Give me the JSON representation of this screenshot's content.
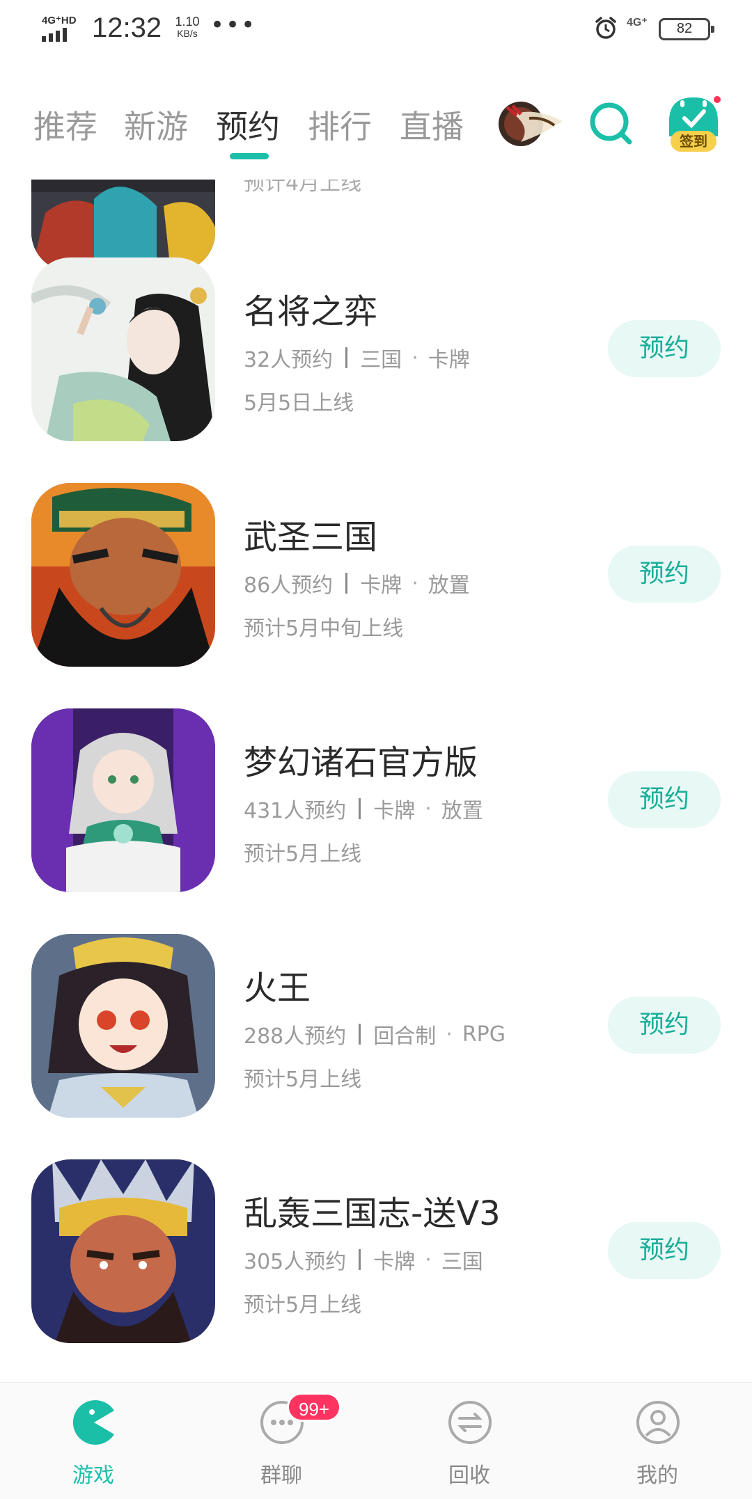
{
  "status_bar": {
    "network": "4G⁺HD",
    "time": "12:32",
    "speed_value": "1.10",
    "speed_unit": "KB/s",
    "more": "•••",
    "network2": "4G⁺",
    "battery": "82"
  },
  "header": {
    "tabs": [
      {
        "label": "推荐"
      },
      {
        "label": "新游"
      },
      {
        "label": "预约",
        "active": true
      },
      {
        "label": "排行"
      },
      {
        "label": "直播"
      }
    ],
    "signin_label": "签到",
    "accent_color": "#1bbfa8"
  },
  "partial_item": {
    "date": "预计4月上线"
  },
  "games": [
    {
      "name": "名将之弈",
      "count": "32人预约",
      "tags": [
        "三国",
        "卡牌"
      ],
      "date": "5月5日上线",
      "button": "预约"
    },
    {
      "name": "武圣三国",
      "count": "86人预约",
      "tags": [
        "卡牌",
        "放置"
      ],
      "date": "预计5月中旬上线",
      "button": "预约"
    },
    {
      "name": "梦幻诸石官方版",
      "count": "431人预约",
      "tags": [
        "卡牌",
        "放置"
      ],
      "date": "预计5月上线",
      "button": "预约"
    },
    {
      "name": "火王",
      "count": "288人预约",
      "tags": [
        "回合制",
        "RPG"
      ],
      "date": "预计5月上线",
      "button": "预约"
    },
    {
      "name": "乱轰三国志-送V3",
      "count": "305人预约",
      "tags": [
        "卡牌",
        "三国"
      ],
      "date": "预计5月上线",
      "button": "预约"
    }
  ],
  "bottom_nav": {
    "items": [
      {
        "label": "游戏",
        "active": true
      },
      {
        "label": "群聊"
      },
      {
        "label": "回收"
      },
      {
        "label": "我的"
      }
    ],
    "badge": "99+"
  }
}
